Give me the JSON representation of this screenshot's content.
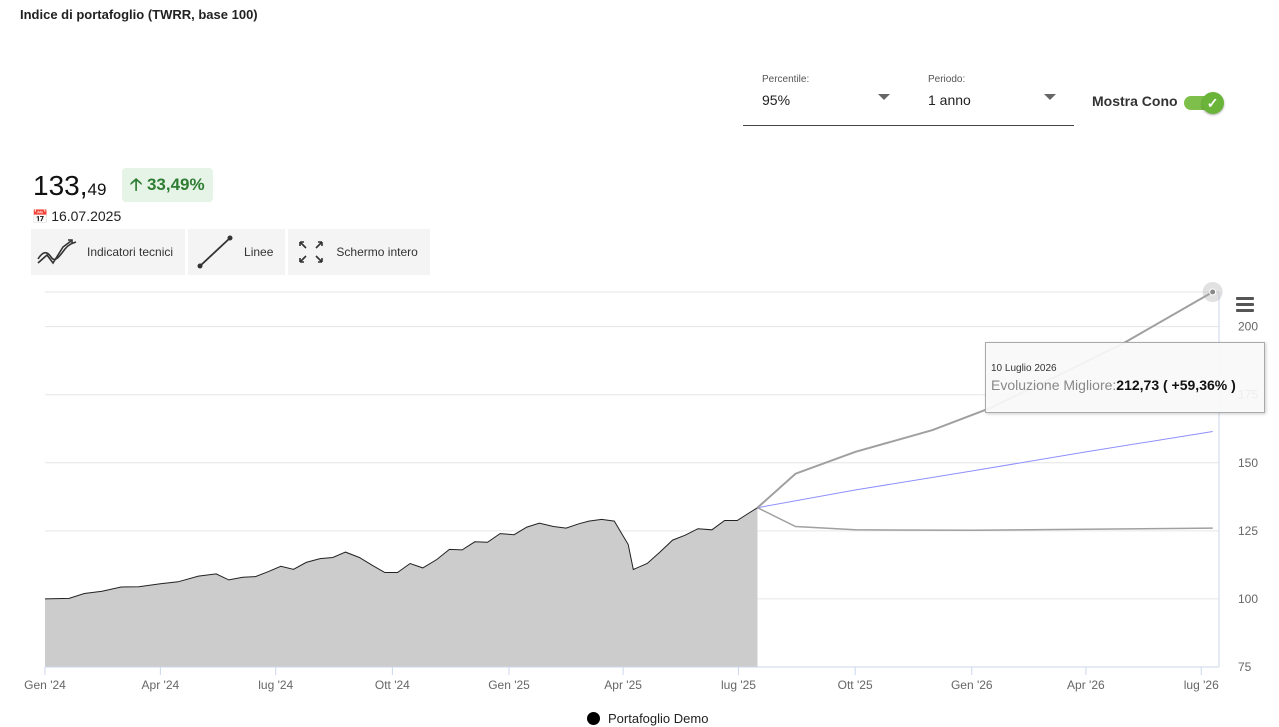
{
  "header": {
    "title": "Indice di portafoglio (TWRR, base 100)"
  },
  "controls": {
    "percentile": {
      "label": "Percentile:",
      "value": "95%"
    },
    "periodo": {
      "label": "Periodo:",
      "value": "1 anno"
    },
    "cone_toggle": {
      "label": "Mostra Cono",
      "on": true
    }
  },
  "summary": {
    "value_int": "133,",
    "value_dec": "49",
    "change": "33,49%",
    "change_icon": "arrow-up-icon",
    "date": "16.07.2025",
    "date_icon": "calendar-icon"
  },
  "toolbar": {
    "indicators_label": "Indicatori tecnici",
    "lines_label": "Linee",
    "fullscreen_label": "Schermo intero"
  },
  "tooltip": {
    "date": "10 Luglio 2026",
    "series": "Evoluzione Migliore:",
    "value": "212,73 ( +59,36% )"
  },
  "legend": {
    "label": "Portafoglio Demo"
  },
  "colors": {
    "accent_green": "#2e7d32",
    "area_fill": "#cccccc",
    "mid_line": "#8f8fff",
    "cone_line": "#a0a0a0"
  },
  "chart_data": {
    "type": "area",
    "ylim": [
      75,
      212.73
    ],
    "y_ticks": [
      75,
      100,
      125,
      150,
      175,
      200
    ],
    "x_start": "2024-01-01",
    "x_end": "2026-07-15",
    "x_ticks": [
      {
        "date": "2024-01-01",
        "label": "Gen '24"
      },
      {
        "date": "2024-04-01",
        "label": "Apr '24"
      },
      {
        "date": "2024-07-01",
        "label": "lug '24"
      },
      {
        "date": "2024-10-01",
        "label": "Ott '24"
      },
      {
        "date": "2025-01-01",
        "label": "Gen '25"
      },
      {
        "date": "2025-04-01",
        "label": "Apr '25"
      },
      {
        "date": "2025-07-01",
        "label": "lug '25"
      },
      {
        "date": "2025-10-01",
        "label": "Ott '25"
      },
      {
        "date": "2026-01-01",
        "label": "Gen '26"
      },
      {
        "date": "2026-04-01",
        "label": "Apr '26"
      },
      {
        "date": "2026-07-01",
        "label": "lug '26"
      }
    ],
    "series": [
      {
        "name": "Portafoglio Demo",
        "points": [
          [
            "2024-01-01",
            100.0
          ],
          [
            "2024-01-20",
            100.2
          ],
          [
            "2024-02-01",
            102.0
          ],
          [
            "2024-02-15",
            102.8
          ],
          [
            "2024-03-01",
            104.4
          ],
          [
            "2024-03-15",
            104.5
          ],
          [
            "2024-04-01",
            105.6
          ],
          [
            "2024-04-15",
            106.3
          ],
          [
            "2024-05-01",
            108.4
          ],
          [
            "2024-05-15",
            109.2
          ],
          [
            "2024-05-25",
            107.0
          ],
          [
            "2024-06-05",
            108.0
          ],
          [
            "2024-06-15",
            108.2
          ],
          [
            "2024-06-25",
            110.0
          ],
          [
            "2024-07-05",
            112.0
          ],
          [
            "2024-07-15",
            110.9
          ],
          [
            "2024-07-25",
            113.4
          ],
          [
            "2024-08-05",
            114.8
          ],
          [
            "2024-08-15",
            115.2
          ],
          [
            "2024-08-25",
            117.2
          ],
          [
            "2024-09-05",
            115.2
          ],
          [
            "2024-09-15",
            112.4
          ],
          [
            "2024-09-25",
            109.7
          ],
          [
            "2024-10-05",
            109.7
          ],
          [
            "2024-10-15",
            113.0
          ],
          [
            "2024-10-25",
            111.4
          ],
          [
            "2024-11-05",
            114.5
          ],
          [
            "2024-11-15",
            118.2
          ],
          [
            "2024-11-25",
            118.0
          ],
          [
            "2024-12-05",
            121.0
          ],
          [
            "2024-12-15",
            120.8
          ],
          [
            "2024-12-25",
            124.0
          ],
          [
            "2025-01-05",
            123.6
          ],
          [
            "2025-01-15",
            126.4
          ],
          [
            "2025-01-25",
            127.8
          ],
          [
            "2025-02-05",
            126.6
          ],
          [
            "2025-02-15",
            126.0
          ],
          [
            "2025-02-25",
            127.6
          ],
          [
            "2025-03-05",
            128.6
          ],
          [
            "2025-03-15",
            129.2
          ],
          [
            "2025-03-25",
            128.6
          ],
          [
            "2025-04-05",
            120.0
          ],
          [
            "2025-04-09",
            110.8
          ],
          [
            "2025-04-20",
            113.0
          ],
          [
            "2025-04-30",
            117.2
          ],
          [
            "2025-05-10",
            121.6
          ],
          [
            "2025-05-20",
            123.4
          ],
          [
            "2025-05-30",
            125.8
          ],
          [
            "2025-06-10",
            125.4
          ],
          [
            "2025-06-20",
            128.8
          ],
          [
            "2025-06-30",
            128.8
          ],
          [
            "2025-07-08",
            131.2
          ],
          [
            "2025-07-16",
            133.49
          ]
        ]
      },
      {
        "name": "Evoluzione Migliore",
        "points": [
          [
            "2025-07-16",
            133.49
          ],
          [
            "2025-08-15",
            146.0
          ],
          [
            "2025-10-01",
            154.0
          ],
          [
            "2025-12-01",
            162.0
          ],
          [
            "2026-01-15",
            170.0
          ],
          [
            "2026-03-01",
            180.0
          ],
          [
            "2026-05-01",
            194.0
          ],
          [
            "2026-07-10",
            212.73
          ]
        ]
      },
      {
        "points": [
          [
            "2025-07-16",
            133.49
          ],
          [
            "2025-10-01",
            140.0
          ],
          [
            "2026-01-01",
            147.0
          ],
          [
            "2026-04-01",
            154.0
          ],
          [
            "2026-07-10",
            161.5
          ]
        ]
      },
      {
        "points": [
          [
            "2025-07-16",
            133.49
          ],
          [
            "2025-08-15",
            126.6
          ],
          [
            "2025-10-01",
            125.4
          ],
          [
            "2026-01-01",
            125.2
          ],
          [
            "2026-04-01",
            125.6
          ],
          [
            "2026-07-10",
            126.0
          ]
        ]
      }
    ],
    "tooltip_point": {
      "date": "2026-07-10",
      "value": 212.73
    },
    "grid": true,
    "legend_position": "bottom-center"
  }
}
